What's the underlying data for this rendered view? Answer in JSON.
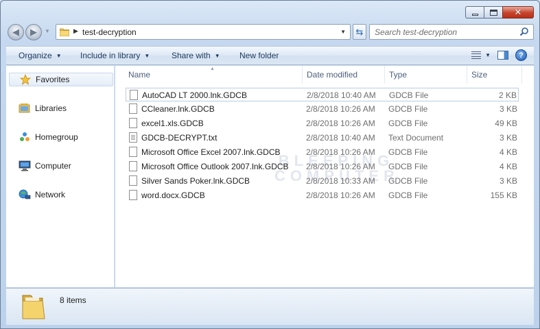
{
  "window": {
    "caption_buttons": {
      "minimize": "minimize",
      "maximize": "maximize",
      "close": "✕"
    }
  },
  "navbar": {
    "address_path": "test-decryption",
    "search_placeholder": "Search test-decryption"
  },
  "commands": {
    "organize": "Organize",
    "include_in_library": "Include in library",
    "share_with": "Share with",
    "new_folder": "New folder"
  },
  "nav_pane": {
    "items": [
      {
        "label": "Favorites",
        "icon": "star-icon",
        "selected": true
      },
      {
        "label": "Libraries",
        "icon": "libraries-icon",
        "selected": false
      },
      {
        "label": "Homegroup",
        "icon": "homegroup-icon",
        "selected": false
      },
      {
        "label": "Computer",
        "icon": "computer-icon",
        "selected": false
      },
      {
        "label": "Network",
        "icon": "network-icon",
        "selected": false
      }
    ]
  },
  "file_list": {
    "columns": {
      "name": "Name",
      "date": "Date modified",
      "type": "Type",
      "size": "Size"
    },
    "sort_column": "name",
    "rows": [
      {
        "name": "AutoCAD LT 2000.lnk.GDCB",
        "date": "2/8/2018 10:40 AM",
        "type": "GDCB File",
        "size": "2 KB",
        "icon": "file-icon",
        "selected": true
      },
      {
        "name": "CCleaner.lnk.GDCB",
        "date": "2/8/2018 10:26 AM",
        "type": "GDCB File",
        "size": "3 KB",
        "icon": "file-icon",
        "selected": false
      },
      {
        "name": "excel1.xls.GDCB",
        "date": "2/8/2018 10:26 AM",
        "type": "GDCB File",
        "size": "49 KB",
        "icon": "file-icon",
        "selected": false
      },
      {
        "name": "GDCB-DECRYPT.txt",
        "date": "2/8/2018 10:40 AM",
        "type": "Text Document",
        "size": "3 KB",
        "icon": "text-file-icon",
        "selected": false
      },
      {
        "name": "Microsoft Office Excel 2007.lnk.GDCB",
        "date": "2/8/2018 10:26 AM",
        "type": "GDCB File",
        "size": "4 KB",
        "icon": "file-icon",
        "selected": false
      },
      {
        "name": "Microsoft Office Outlook 2007.lnk.GDCB",
        "date": "2/8/2018 10:26 AM",
        "type": "GDCB File",
        "size": "4 KB",
        "icon": "file-icon",
        "selected": false
      },
      {
        "name": "Silver Sands Poker.lnk.GDCB",
        "date": "2/8/2018 10:33 AM",
        "type": "GDCB File",
        "size": "3 KB",
        "icon": "file-icon",
        "selected": false
      },
      {
        "name": "word.docx.GDCB",
        "date": "2/8/2018 10:26 AM",
        "type": "GDCB File",
        "size": "155 KB",
        "icon": "file-icon",
        "selected": false
      }
    ]
  },
  "watermark": {
    "line1": "BLEEPING",
    "line2": "COMPUTER"
  },
  "details": {
    "item_count": "8 items"
  },
  "colors": {
    "close_button": "#c6432c",
    "frame": "#c5d8ef",
    "link_blue": "#1e395b"
  }
}
